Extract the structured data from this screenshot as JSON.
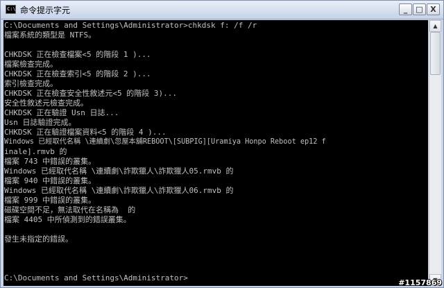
{
  "window": {
    "title": "命令提示字元",
    "icon": "cmd-icon",
    "icon_text": "C:\\",
    "buttons": {
      "minimize": "_",
      "maximize": "□",
      "close": "X"
    }
  },
  "console": {
    "lines": [
      "C:\\Documents and Settings\\Administrator>chkdsk f: /f /r",
      "檔案系統的類型是 NTFS。",
      "",
      "CHKDSK 正在檢查檔案<5 的階段 1 )...",
      "檔案檢查完成。",
      "CHKDSK 正在檢查索引<5 的階段 2 )...",
      "索引檢查完成。",
      "CHKDSK 正在檢查安全性敘述元<5 的階段 3)...",
      "安全性敘述元檢查完成。",
      "CHKDSK 正在驗證 Usn 日誌...",
      "Usn 日誌驗證完成。",
      "CHKDSK 正在驗證檔案資料<5 的階段 4 )...",
      "Windows 已經取代名稱 \\連續劇\\忽屋本舖REBOOT\\[SUBPIG][Uramiya Honpo Reboot ep12 f",
      "inale].rmvb 的",
      "檔案 743 中錯誤的叢集。",
      "Windows 已經取代名稱 \\連續劇\\詐欺獵人\\詐欺獵人05.rmvb 的",
      "檔案 940 中錯誤的叢集。",
      "Windows 已經取代名稱 \\連續劇\\詐欺獵人\\詐欺獵人06.rmvb 的",
      "檔案 999 中錯誤的叢集。",
      "磁碟空間不足，無法取代在名稱為  的",
      "檔案 4405 中所偵測到的錯誤叢集。",
      "",
      "發生未指定的錯誤。",
      "",
      "",
      "C:\\Documents and Settings\\Administrator>"
    ]
  },
  "watermark": "#1157869"
}
